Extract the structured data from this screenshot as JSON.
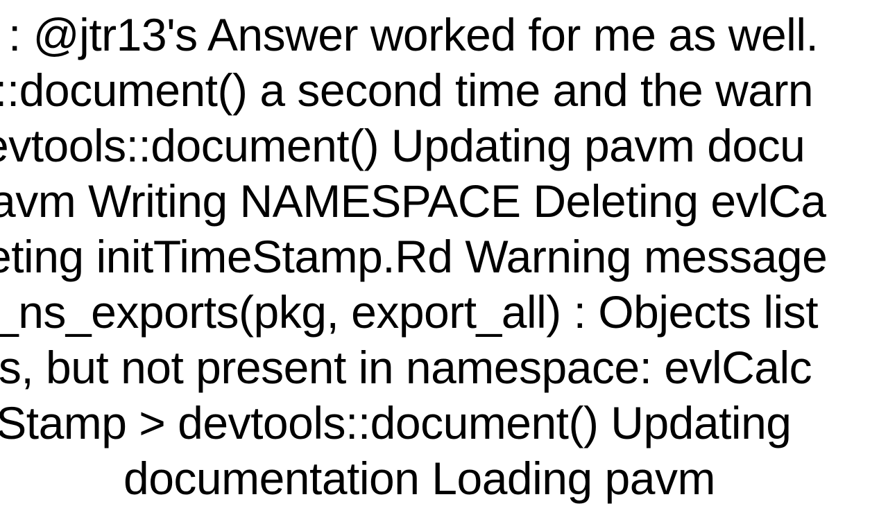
{
  "lines": {
    "l1": ": @jtr13's Answer worked for me as well.",
    "l2": "::document() a second time and the warn",
    "l3": "evtools::document() Updating pavm docu",
    "l4": "avm Writing NAMESPACE Deleting evlCa",
    "l5": "eting initTimeStamp.Rd Warning message",
    "l6": "_ns_exports(pkg, export_all) : Objects list",
    "l7": "ts, but not present in namespace: evlCalc",
    "l8": "eStamp  > devtools::document() Updating",
    "l9": "documentation Loading pavm"
  }
}
